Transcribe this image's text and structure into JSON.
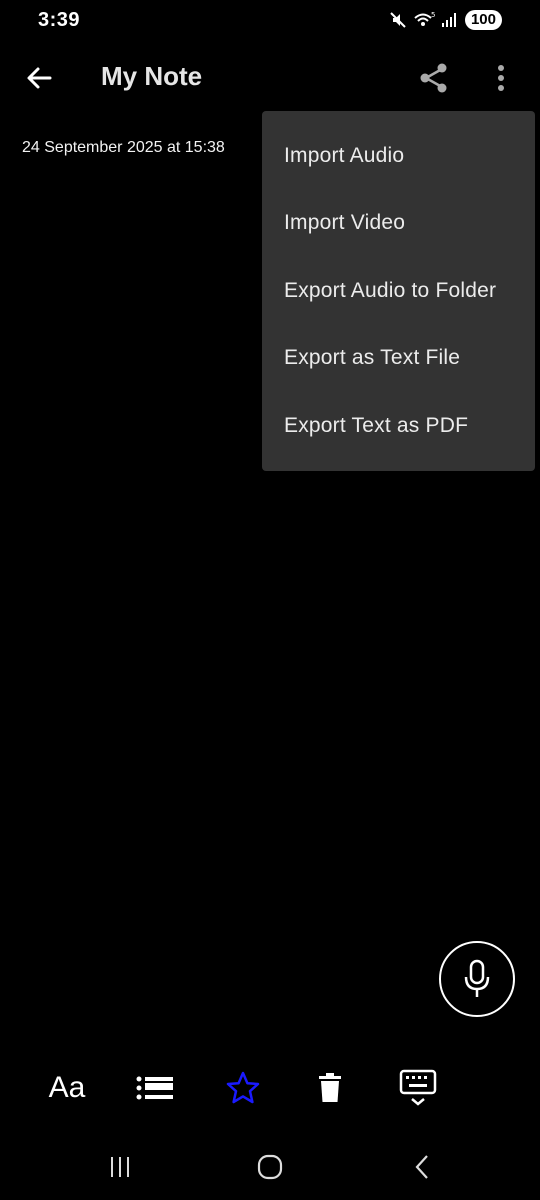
{
  "status_bar": {
    "time": "3:39",
    "battery": "100",
    "icons": [
      "mute-icon",
      "wifi-icon",
      "signal-icon"
    ]
  },
  "app_bar": {
    "title": "My Note",
    "icons": [
      "back-arrow-icon",
      "share-icon",
      "more-vert-icon"
    ]
  },
  "note": {
    "date": "24 September 2025 at 15:38"
  },
  "overflow_menu": {
    "items": [
      {
        "label": "Import Audio"
      },
      {
        "label": "Import Video"
      },
      {
        "label": "Export Audio to Folder"
      },
      {
        "label": "Export as Text File"
      },
      {
        "label": "Export Text as PDF"
      }
    ]
  },
  "fab": {
    "icon": "microphone-icon"
  },
  "toolbar": {
    "text_format_label": "Aa",
    "icons": [
      "text-format-icon",
      "list-icon",
      "star-icon",
      "trash-icon",
      "keyboard-hide-icon"
    ],
    "star_color": "#1a1aff"
  },
  "nav_bar": {
    "icons": [
      "recents-icon",
      "home-icon",
      "back-icon"
    ]
  },
  "colors": {
    "background": "#000000",
    "menu_background": "#333333",
    "text": "#ececec"
  }
}
